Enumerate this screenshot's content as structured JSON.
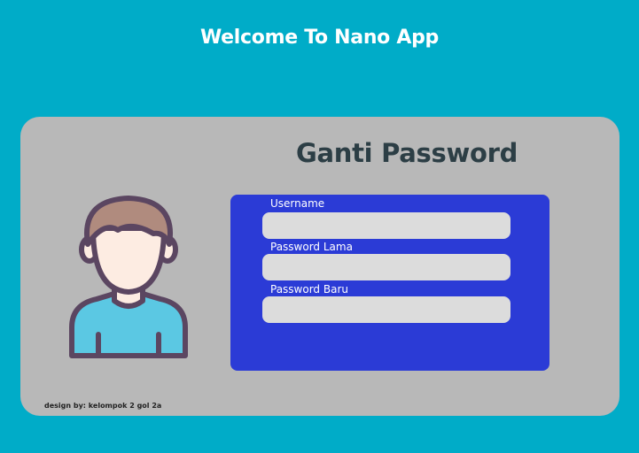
{
  "header": {
    "title": "Welcome To Nano App"
  },
  "card": {
    "title": "Ganti Password",
    "avatar_icon": "user-avatar-icon",
    "fields": [
      {
        "label": "Username",
        "value": "",
        "placeholder": ""
      },
      {
        "label": "Password Lama",
        "value": "",
        "placeholder": ""
      },
      {
        "label": "Password Baru",
        "value": "",
        "placeholder": ""
      }
    ],
    "credit": "design by: kelompok 2 gol 2a"
  },
  "colors": {
    "background": "#00acc8",
    "card": "#b8b8b8",
    "form_panel": "#2b3bd6",
    "input": "#dcdcdc",
    "title_text": "#2c3e45",
    "avatar_outline": "#5b4661",
    "avatar_hair": "#b08b7e",
    "avatar_skin": "#fdece2",
    "avatar_shirt": "#5bc8e3"
  }
}
